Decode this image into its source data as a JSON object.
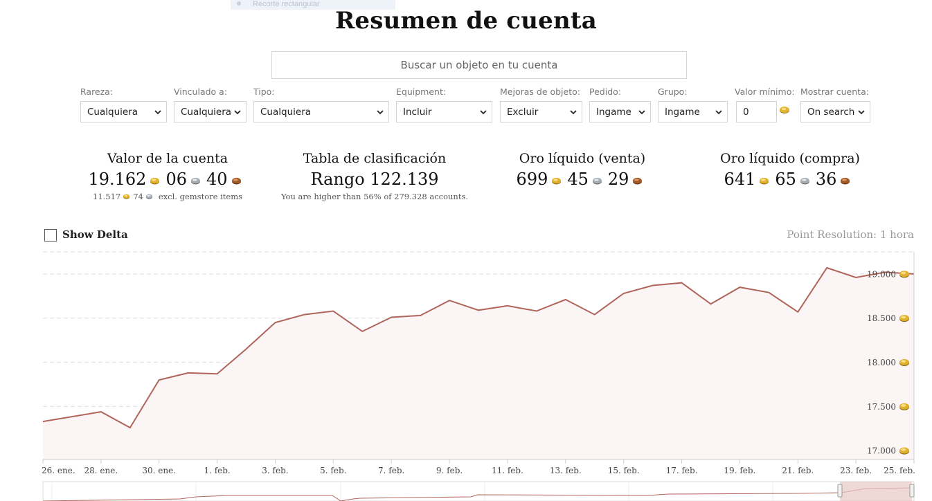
{
  "tooltip_ghost": "Recorte rectangular",
  "page_title": "Resumen de cuenta",
  "search": {
    "placeholder": "Buscar un objeto en tu cuenta"
  },
  "filters": [
    {
      "label": "Rareza:",
      "value": "Cualquiera"
    },
    {
      "label": "Vinculado a:",
      "value": "Cualquiera"
    },
    {
      "label": "Tipo:",
      "value": "Cualquiera"
    },
    {
      "label": "Equipment:",
      "value": "Incluir"
    },
    {
      "label": "Mejoras de objeto:",
      "value": "Excluir"
    },
    {
      "label": "Pedido:",
      "value": "Ingame"
    },
    {
      "label": "Grupo:",
      "value": "Ingame"
    },
    {
      "label": "Valor mínimo:",
      "value": "0"
    },
    {
      "label": "Mostrar cuenta:",
      "value": "On search"
    }
  ],
  "stats": {
    "account_value": {
      "title": "Valor de la cuenta",
      "gold": "19.162",
      "silver": "06",
      "copper": "40",
      "sub_gold": "11.517",
      "sub_silver": "74",
      "sub_text": "excl. gemstore items"
    },
    "leaderboard": {
      "title": "Tabla de clasificación",
      "value": "Rango 122.139",
      "sub_text": "You are higher than 56% of 279.328 accounts."
    },
    "liquid_sell": {
      "title": "Oro líquido (venta)",
      "gold": "699",
      "silver": "45",
      "copper": "29"
    },
    "liquid_buy": {
      "title": "Oro líquido (compra)",
      "gold": "641",
      "silver": "65",
      "copper": "36"
    }
  },
  "show_delta": {
    "label": "Show Delta",
    "checked": false
  },
  "point_resolution": "Point Resolution: 1 hora",
  "colors": {
    "line": "#b0655a",
    "area": "#fbf5f5",
    "grid": "#dddddd",
    "gold": "#d4a21a",
    "silver": "#9aa0a6",
    "copper": "#a0582a",
    "nav_handle": "#e8c9c6"
  },
  "chart_data": {
    "type": "area",
    "x": [
      "2025-01-26",
      "2025-01-28",
      "2025-01-29",
      "2025-01-30",
      "2025-01-31",
      "2025-02-01",
      "2025-02-02",
      "2025-02-03",
      "2025-02-04",
      "2025-02-05",
      "2025-02-06",
      "2025-02-07",
      "2025-02-08",
      "2025-02-09",
      "2025-02-10",
      "2025-02-11",
      "2025-02-12",
      "2025-02-13",
      "2025-02-14",
      "2025-02-15",
      "2025-02-16",
      "2025-02-17",
      "2025-02-18",
      "2025-02-19",
      "2025-02-20",
      "2025-02-21",
      "2025-02-22",
      "2025-02-23",
      "2025-02-24",
      "2025-02-25"
    ],
    "values": [
      17330,
      17440,
      17260,
      17800,
      17880,
      17870,
      18150,
      18450,
      18540,
      18580,
      18350,
      18510,
      18530,
      18700,
      18590,
      18640,
      18580,
      18710,
      18540,
      18780,
      18870,
      18900,
      18660,
      18850,
      18790,
      18570,
      19070,
      18960,
      19020,
      19000
    ],
    "x_tick_labels": [
      "26. ene.",
      "28. ene.",
      "30. ene.",
      "1. feb.",
      "3. feb.",
      "5. feb.",
      "7. feb.",
      "9. feb.",
      "11. feb.",
      "13. feb.",
      "15. feb.",
      "17. feb.",
      "19. feb.",
      "21. feb.",
      "23. feb.",
      "25. feb."
    ],
    "y_ticks": [
      17000,
      17500,
      18000,
      18500,
      19000
    ],
    "y_tick_labels": [
      "17.000",
      "17.500",
      "18.000",
      "18.500",
      "19.000"
    ],
    "ylim": [
      16900,
      19250
    ],
    "grid": true
  }
}
